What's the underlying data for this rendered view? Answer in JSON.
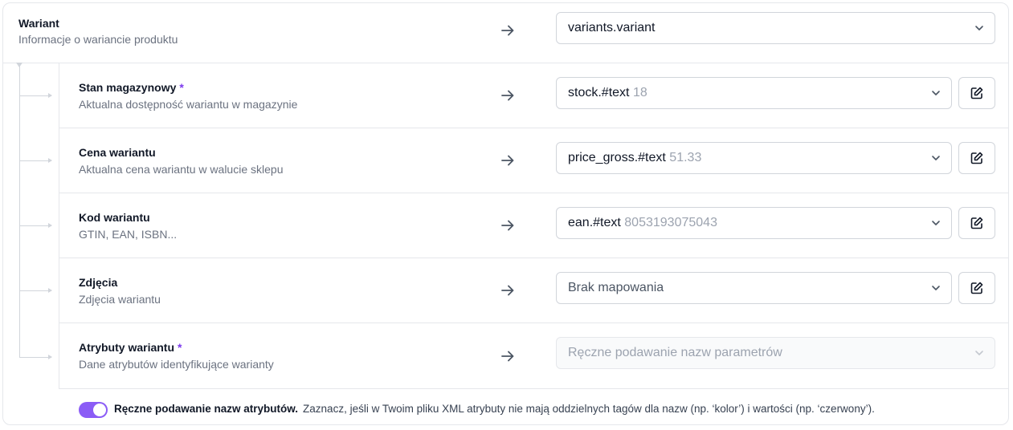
{
  "variant": {
    "title": "Wariant",
    "description": "Informacje o wariancie produktu",
    "mapping": "variants.variant"
  },
  "fields": [
    {
      "title": "Stan magazynowy",
      "required": "*",
      "description": "Aktualna dostępność wariantu w magazynie",
      "mapping": "stock.#text",
      "sample": "18"
    },
    {
      "title": "Cena wariantu",
      "required": "",
      "description": "Aktualna cena wariantu w walucie sklepu",
      "mapping": "price_gross.#text",
      "sample": "51.33"
    },
    {
      "title": "Kod wariantu",
      "required": "",
      "description": "GTIN, EAN, ISBN...",
      "mapping": "ean.#text",
      "sample": "8053193075043"
    },
    {
      "title": "Zdjęcia",
      "required": "",
      "description": "Zdjęcia wariantu",
      "mapping": "Brak mapowania",
      "sample": ""
    },
    {
      "title": "Atrybuty wariantu",
      "required": "*",
      "description": "Dane atrybutów identyfikujące warianty",
      "mapping": "Ręczne podawanie nazw parametrów",
      "sample": ""
    }
  ],
  "toggle": {
    "state": "on",
    "label": "Ręczne podawanie nazw atrybutów.",
    "hint": "Zaznacz, jeśli w Twoim pliku XML atrybuty nie mają oddzielnych tagów dla nazw (np. ‘kolor’) i wartości (np. ‘czerwony’)."
  },
  "colors": {
    "accent": "#8b5cf6",
    "required": "#7c3aed",
    "border": "#e5e7eb"
  },
  "icons": {
    "arrow": "arrow-right-icon",
    "chevron": "chevron-down-icon",
    "edit": "edit-icon"
  }
}
